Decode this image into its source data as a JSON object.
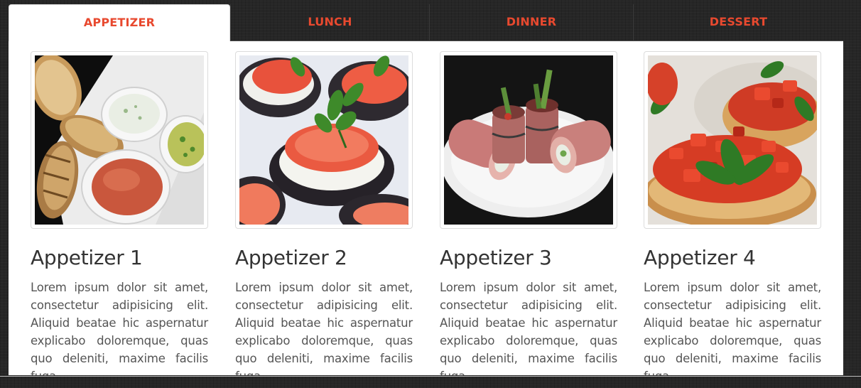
{
  "tabs": [
    {
      "label": "APPETIZER",
      "active": true
    },
    {
      "label": "LUNCH",
      "active": false
    },
    {
      "label": "DINNER",
      "active": false
    },
    {
      "label": "DESSERT",
      "active": false
    }
  ],
  "accent_color": "#e8492f",
  "cards": [
    {
      "title": "Appetizer 1",
      "image_icon": "bread-and-dips-photo",
      "text": "Lorem ipsum dolor sit amet, consectetur adipisicing elit. Aliquid beatae hic aspernatur explicabo doloremque, quas quo deleniti, maxime facilis fuga."
    },
    {
      "title": "Appetizer 2",
      "image_icon": "eggplant-tomato-photo",
      "text": "Lorem ipsum dolor sit amet, consectetur adipisicing elit. Aliquid beatae hic aspernatur explicabo doloremque, quas quo deleniti, maxime facilis fuga."
    },
    {
      "title": "Appetizer 3",
      "image_icon": "ham-rolls-photo",
      "text": "Lorem ipsum dolor sit amet, consectetur adipisicing elit. Aliquid beatae hic aspernatur explicabo doloremque, quas quo deleniti, maxime facilis fuga."
    },
    {
      "title": "Appetizer 4",
      "image_icon": "bruschetta-photo",
      "text": "Lorem ipsum dolor sit amet, consectetur adipisicing elit. Aliquid beatae hic aspernatur explicabo doloremque, quas quo deleniti, maxime facilis fuga."
    }
  ]
}
